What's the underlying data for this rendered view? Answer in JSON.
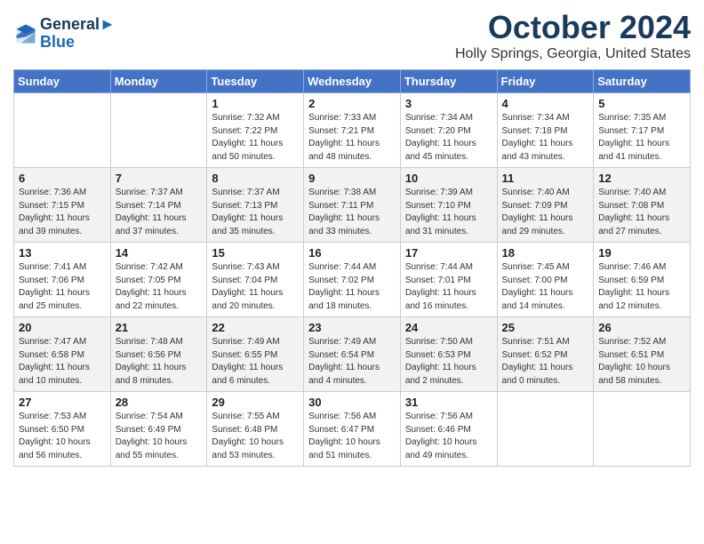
{
  "header": {
    "logo_line1": "General",
    "logo_line2": "Blue",
    "month_title": "October 2024",
    "location": "Holly Springs, Georgia, United States"
  },
  "weekdays": [
    "Sunday",
    "Monday",
    "Tuesday",
    "Wednesday",
    "Thursday",
    "Friday",
    "Saturday"
  ],
  "weeks": [
    [
      {
        "day": "",
        "info": ""
      },
      {
        "day": "",
        "info": ""
      },
      {
        "day": "1",
        "info": "Sunrise: 7:32 AM\nSunset: 7:22 PM\nDaylight: 11 hours and 50 minutes."
      },
      {
        "day": "2",
        "info": "Sunrise: 7:33 AM\nSunset: 7:21 PM\nDaylight: 11 hours and 48 minutes."
      },
      {
        "day": "3",
        "info": "Sunrise: 7:34 AM\nSunset: 7:20 PM\nDaylight: 11 hours and 45 minutes."
      },
      {
        "day": "4",
        "info": "Sunrise: 7:34 AM\nSunset: 7:18 PM\nDaylight: 11 hours and 43 minutes."
      },
      {
        "day": "5",
        "info": "Sunrise: 7:35 AM\nSunset: 7:17 PM\nDaylight: 11 hours and 41 minutes."
      }
    ],
    [
      {
        "day": "6",
        "info": "Sunrise: 7:36 AM\nSunset: 7:15 PM\nDaylight: 11 hours and 39 minutes."
      },
      {
        "day": "7",
        "info": "Sunrise: 7:37 AM\nSunset: 7:14 PM\nDaylight: 11 hours and 37 minutes."
      },
      {
        "day": "8",
        "info": "Sunrise: 7:37 AM\nSunset: 7:13 PM\nDaylight: 11 hours and 35 minutes."
      },
      {
        "day": "9",
        "info": "Sunrise: 7:38 AM\nSunset: 7:11 PM\nDaylight: 11 hours and 33 minutes."
      },
      {
        "day": "10",
        "info": "Sunrise: 7:39 AM\nSunset: 7:10 PM\nDaylight: 11 hours and 31 minutes."
      },
      {
        "day": "11",
        "info": "Sunrise: 7:40 AM\nSunset: 7:09 PM\nDaylight: 11 hours and 29 minutes."
      },
      {
        "day": "12",
        "info": "Sunrise: 7:40 AM\nSunset: 7:08 PM\nDaylight: 11 hours and 27 minutes."
      }
    ],
    [
      {
        "day": "13",
        "info": "Sunrise: 7:41 AM\nSunset: 7:06 PM\nDaylight: 11 hours and 25 minutes."
      },
      {
        "day": "14",
        "info": "Sunrise: 7:42 AM\nSunset: 7:05 PM\nDaylight: 11 hours and 22 minutes."
      },
      {
        "day": "15",
        "info": "Sunrise: 7:43 AM\nSunset: 7:04 PM\nDaylight: 11 hours and 20 minutes."
      },
      {
        "day": "16",
        "info": "Sunrise: 7:44 AM\nSunset: 7:02 PM\nDaylight: 11 hours and 18 minutes."
      },
      {
        "day": "17",
        "info": "Sunrise: 7:44 AM\nSunset: 7:01 PM\nDaylight: 11 hours and 16 minutes."
      },
      {
        "day": "18",
        "info": "Sunrise: 7:45 AM\nSunset: 7:00 PM\nDaylight: 11 hours and 14 minutes."
      },
      {
        "day": "19",
        "info": "Sunrise: 7:46 AM\nSunset: 6:59 PM\nDaylight: 11 hours and 12 minutes."
      }
    ],
    [
      {
        "day": "20",
        "info": "Sunrise: 7:47 AM\nSunset: 6:58 PM\nDaylight: 11 hours and 10 minutes."
      },
      {
        "day": "21",
        "info": "Sunrise: 7:48 AM\nSunset: 6:56 PM\nDaylight: 11 hours and 8 minutes."
      },
      {
        "day": "22",
        "info": "Sunrise: 7:49 AM\nSunset: 6:55 PM\nDaylight: 11 hours and 6 minutes."
      },
      {
        "day": "23",
        "info": "Sunrise: 7:49 AM\nSunset: 6:54 PM\nDaylight: 11 hours and 4 minutes."
      },
      {
        "day": "24",
        "info": "Sunrise: 7:50 AM\nSunset: 6:53 PM\nDaylight: 11 hours and 2 minutes."
      },
      {
        "day": "25",
        "info": "Sunrise: 7:51 AM\nSunset: 6:52 PM\nDaylight: 11 hours and 0 minutes."
      },
      {
        "day": "26",
        "info": "Sunrise: 7:52 AM\nSunset: 6:51 PM\nDaylight: 10 hours and 58 minutes."
      }
    ],
    [
      {
        "day": "27",
        "info": "Sunrise: 7:53 AM\nSunset: 6:50 PM\nDaylight: 10 hours and 56 minutes."
      },
      {
        "day": "28",
        "info": "Sunrise: 7:54 AM\nSunset: 6:49 PM\nDaylight: 10 hours and 55 minutes."
      },
      {
        "day": "29",
        "info": "Sunrise: 7:55 AM\nSunset: 6:48 PM\nDaylight: 10 hours and 53 minutes."
      },
      {
        "day": "30",
        "info": "Sunrise: 7:56 AM\nSunset: 6:47 PM\nDaylight: 10 hours and 51 minutes."
      },
      {
        "day": "31",
        "info": "Sunrise: 7:56 AM\nSunset: 6:46 PM\nDaylight: 10 hours and 49 minutes."
      },
      {
        "day": "",
        "info": ""
      },
      {
        "day": "",
        "info": ""
      }
    ]
  ]
}
